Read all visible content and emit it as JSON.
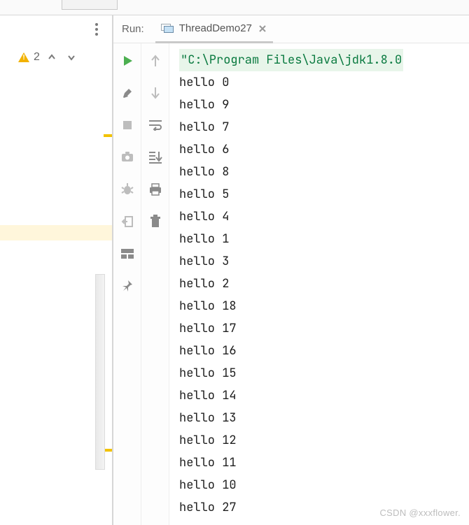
{
  "run_panel": {
    "title": "Run:",
    "tab": {
      "label": "ThreadDemo27"
    }
  },
  "left": {
    "warning_count": "2"
  },
  "console": {
    "command": "\"C:\\Program Files\\Java\\jdk1.8.0",
    "lines": [
      "hello 0",
      "hello 9",
      "hello 7",
      "hello 6",
      "hello 8",
      "hello 5",
      "hello 4",
      "hello 1",
      "hello 3",
      "hello 2",
      "hello 18",
      "hello 17",
      "hello 16",
      "hello 15",
      "hello 14",
      "hello 13",
      "hello 12",
      "hello 11",
      "hello 10",
      "hello 27"
    ]
  },
  "watermark": "CSDN @xxxflower."
}
